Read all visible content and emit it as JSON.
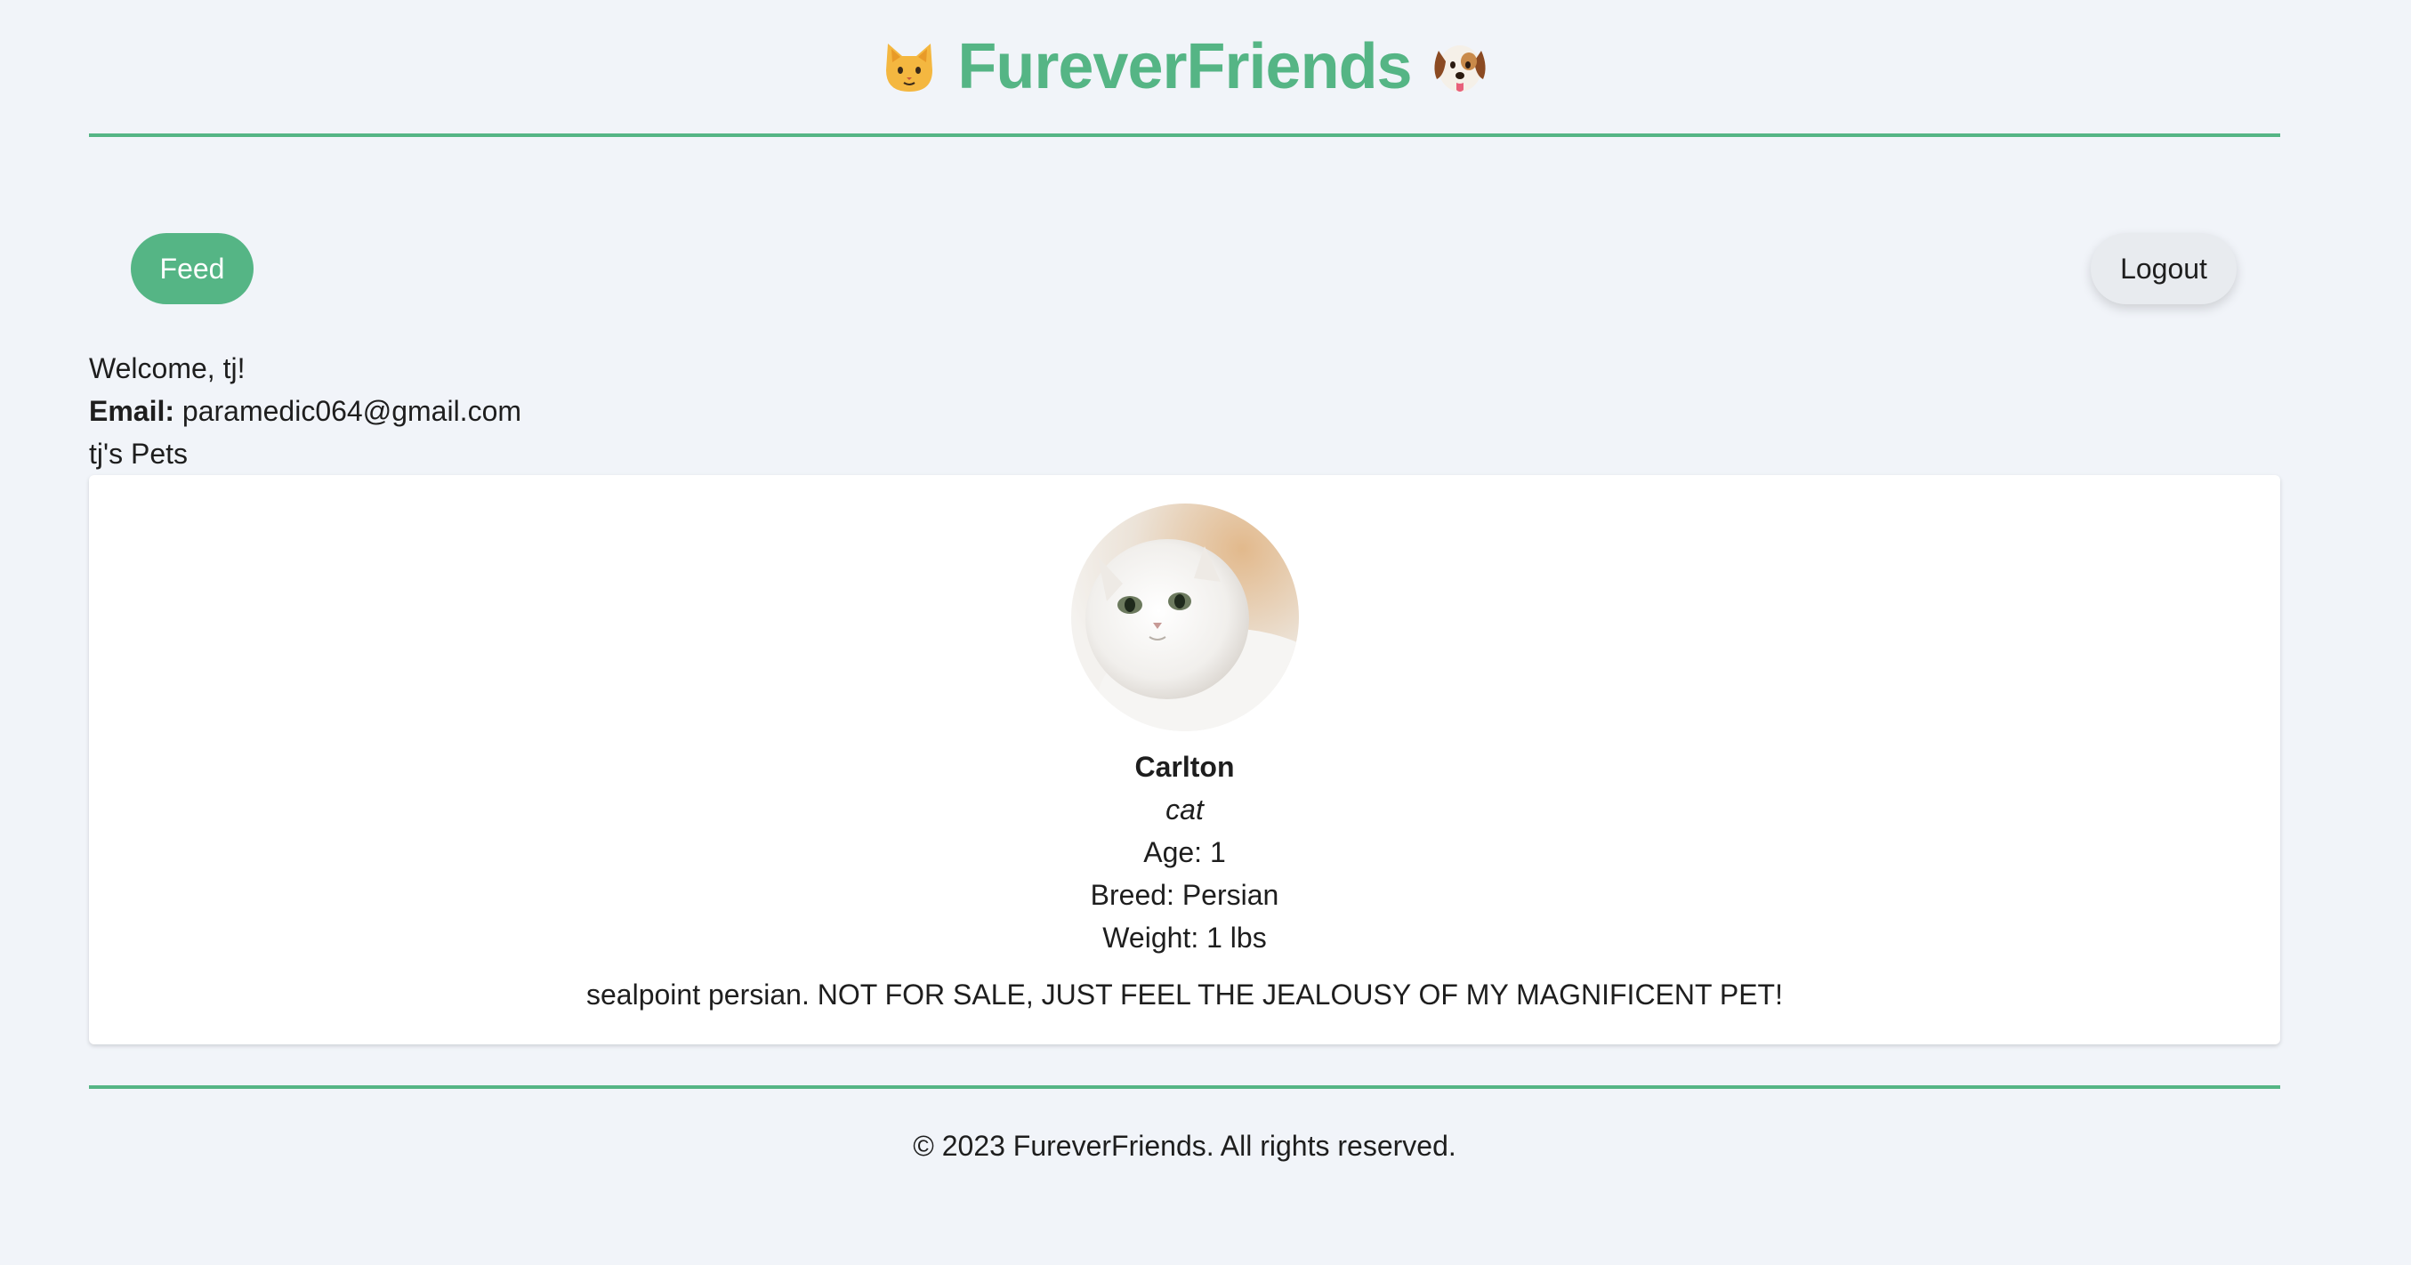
{
  "header": {
    "title": "FureverFriends",
    "left_icon": "cat-face-icon",
    "right_icon": "dog-face-icon"
  },
  "nav": {
    "feed_label": "Feed",
    "logout_label": "Logout"
  },
  "user": {
    "welcome": "Welcome, tj!",
    "email_label": "Email:",
    "email_value": "paramedic064@gmail.com",
    "pets_heading": "tj's Pets"
  },
  "pet": {
    "photo": "white-persian-cat-photo",
    "name": "Carlton",
    "species": "cat",
    "age": "Age: 1",
    "breed": "Breed: Persian",
    "weight": "Weight: 1 lbs",
    "description": "sealpoint persian. NOT FOR SALE, JUST FEEL THE JEALOUSY OF MY MAGNIFICENT PET!"
  },
  "footer": {
    "copyright": "© 2023 FureverFriends. All rights reserved."
  },
  "colors": {
    "brand": "#55b585",
    "background": "#f1f4f9",
    "card": "#ffffff",
    "logout_bg": "#e8ebef"
  }
}
